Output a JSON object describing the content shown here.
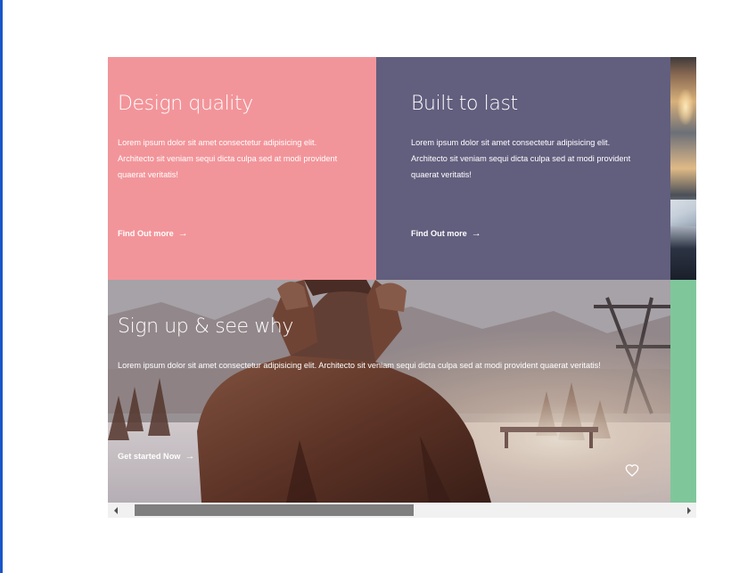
{
  "tiles": {
    "design": {
      "title": "Design quality",
      "body": "Lorem ipsum dolor sit amet consectetur adipisicing elit. Architecto sit veniam sequi dicta culpa sed at modi provident quaerat veritatis!",
      "link": "Find Out more",
      "color": "#f2959a"
    },
    "built": {
      "title": "Built to last",
      "body": "Lorem ipsum dolor sit amet consectetur adipisicing elit. Architecto sit veniam sequi dicta culpa sed at modi provident quaerat veritatis!",
      "link": "Find Out more",
      "color": "#625e7e"
    },
    "signup": {
      "title": "Sign up & see why",
      "body": "Lorem ipsum dolor sit amet consectetur adipisicing elit. Architecto sit veniam sequi dicta culpa sed at modi provident quaerat veritatis!",
      "link": "Get started Now"
    },
    "accent_green": "#7fc79a"
  },
  "icons": {
    "arrow": "arrow-right-icon",
    "favorite": "heart-icon"
  },
  "arrow_glyph": "→",
  "scrollbar": {
    "position": 0.0
  }
}
